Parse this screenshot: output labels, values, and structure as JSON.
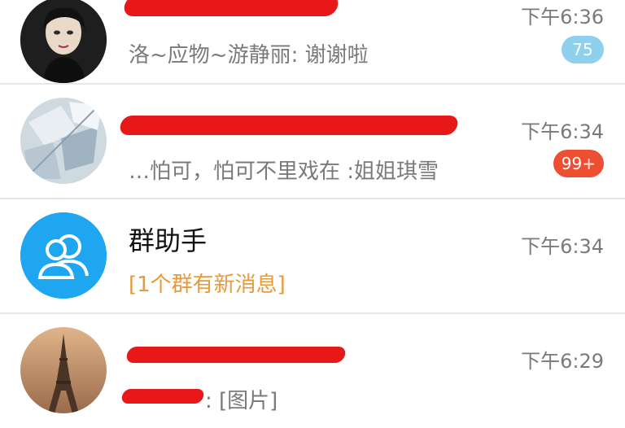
{
  "conversations": [
    {
      "title": "",
      "preview": "洛~应物~游静丽: 谢谢啦",
      "time": "下午6:36",
      "badge": "75",
      "badge_color": "#8fd0ee",
      "avatar_icon": "portrait-photo-icon"
    },
    {
      "title": "",
      "preview": "…怕可，怕可不里戏在 :姐姐琪雪",
      "time": "下午6:34",
      "badge": "99+",
      "badge_color": "#ec4f32",
      "avatar_icon": "abstract-photo-icon"
    },
    {
      "title": "群助手",
      "preview": "[1个群有新消息]",
      "preview_color": "#e89a3a",
      "time": "下午6:34",
      "avatar_color": "#1ea7f0",
      "avatar_icon": "group-assistant-icon"
    },
    {
      "title": "",
      "preview": ": [图片]",
      "time": "下午6:29",
      "avatar_icon": "eiffel-tower-photo-icon"
    }
  ],
  "colors": {
    "redaction": "#e81818",
    "divider": "#e6e6e6"
  }
}
